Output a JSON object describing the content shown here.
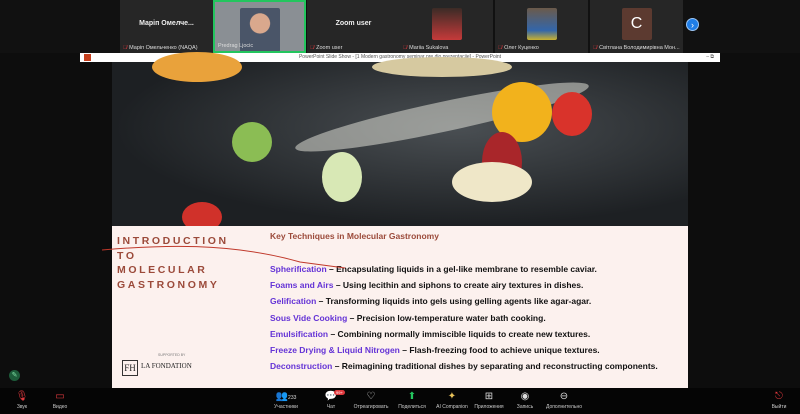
{
  "gallery": {
    "tiles": [
      {
        "big": "Маріп Омелче...",
        "name": "Маріп Омельченко (NAQA)"
      },
      {
        "big": "",
        "name": "Predrag Ljocic"
      },
      {
        "big": "Zoom user",
        "name": "Zoom user"
      },
      {
        "big": "",
        "name": "Mariia Sukalova"
      },
      {
        "big": "",
        "name": "Олег Куценко"
      },
      {
        "big": "C",
        "name": "Світлана Володимирівна Мон..."
      }
    ],
    "next": "›"
  },
  "titlebar": {
    "title": "PowerPoint Slide Show - [1 Modern gastronomy seminar pre dio prezentacije] - PowerPoint",
    "controls": "–  ⧉"
  },
  "slide": {
    "intro": [
      "INTRODUCTION",
      "TO",
      "MOLECULAR",
      "GASTRONOMY"
    ],
    "heading": "Key Techniques in Molecular Gastronomy",
    "items": [
      {
        "term": "Spherification",
        "desc": " – Encapsulating liquids in a gel-like membrane to resemble caviar."
      },
      {
        "term": "Foams and Airs",
        "desc": " – Using lecithin and siphons to create airy textures in dishes."
      },
      {
        "term": "Gelification",
        "desc": " – Transforming liquids into gels using gelling agents like agar-agar."
      },
      {
        "term": "Sous Vide Cooking",
        "desc": " – Precision low-temperature water bath cooking."
      },
      {
        "term": "Emulsification",
        "desc": " – Combining normally immiscible liquids to create new textures."
      },
      {
        "term": "Freeze Drying & Liquid Nitrogen",
        "desc": " – Flash-freezing food to achieve unique textures."
      },
      {
        "term": "Deconstruction",
        "desc": " – Reimagining traditional dishes by separating and reconstructing components."
      }
    ],
    "logo": {
      "supported": "SUPPORTED BY",
      "mark": "FH",
      "name": "LA FONDATION"
    }
  },
  "toolbar": {
    "audio": "Звук",
    "video": "Видео",
    "participants": "Участники",
    "participants_count": "233",
    "chat": "Чат",
    "chat_badge": "99+",
    "react": "Отреагировать",
    "share": "Поделиться",
    "ai": "AI Companion",
    "apps": "Приложения",
    "record": "Запись",
    "more": "Дополнительно",
    "leave": "Выйти"
  }
}
